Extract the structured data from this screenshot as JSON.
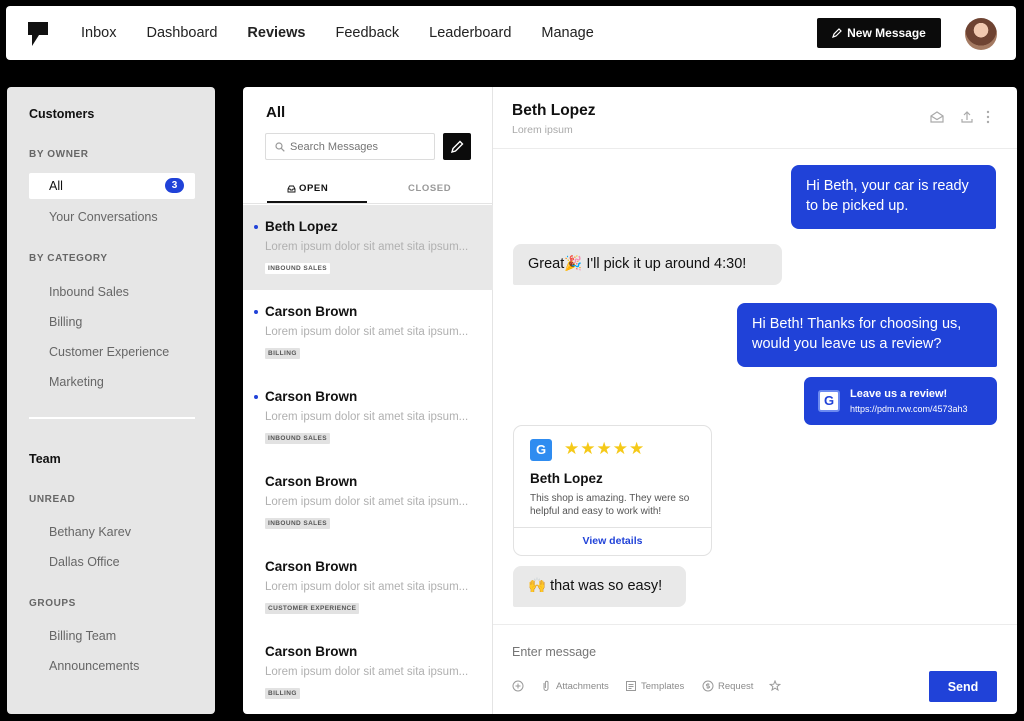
{
  "nav": {
    "items": [
      "Inbox",
      "Dashboard",
      "Reviews",
      "Feedback",
      "Leaderboard",
      "Manage"
    ],
    "active": "Reviews",
    "new_message": "New Message"
  },
  "sidebar": {
    "customers_title": "Customers",
    "by_owner": "BY OWNER",
    "all_label": "All",
    "all_count": "3",
    "your_conversations": "Your Conversations",
    "by_category": "BY CATEGORY",
    "categories": [
      "Inbound Sales",
      "Billing",
      "Customer Experience",
      "Marketing"
    ],
    "team_title": "Team",
    "unread": "UNREAD",
    "unread_items": [
      "Bethany Karev",
      "Dallas Office"
    ],
    "groups": "GROUPS",
    "group_items": [
      "Billing Team",
      "Announcements"
    ]
  },
  "list": {
    "title": "All",
    "search_placeholder": "Search Messages",
    "tab_open": "OPEN",
    "tab_closed": "CLOSED",
    "conversations": [
      {
        "name": "Beth Lopez",
        "preview": "Lorem ipsum dolor sit amet sita ipsum...",
        "tag": "INBOUND SALES"
      },
      {
        "name": "Carson Brown",
        "preview": "Lorem ipsum dolor sit amet sita ipsum...",
        "tag": "BILLING"
      },
      {
        "name": "Carson Brown",
        "preview": "Lorem ipsum dolor sit amet sita ipsum...",
        "tag": "INBOUND SALES"
      },
      {
        "name": "Carson Brown",
        "preview": "Lorem ipsum dolor sit amet sita ipsum...",
        "tag": "INBOUND SALES"
      },
      {
        "name": "Carson Brown",
        "preview": "Lorem ipsum dolor sit amet sita ipsum...",
        "tag": "CUSTOMER EXPERIENCE"
      },
      {
        "name": "Carson Brown",
        "preview": "Lorem ipsum dolor sit amet sita ipsum...",
        "tag": "BILLING"
      }
    ]
  },
  "conversation": {
    "name": "Beth Lopez",
    "subtitle": "Lorem ipsum",
    "messages": {
      "m1": "Hi Beth, your car is ready to be picked up.",
      "m2": "Great🎉 I'll pick it up around 4:30!",
      "m3": "Hi Beth! Thanks for choosing us, would you leave us a review?",
      "m6": "🙌 that was so easy!"
    },
    "link": {
      "title": "Leave us a review!",
      "url": "https://pdm.rvw.com/4573ah3"
    },
    "review": {
      "g": "G",
      "stars": "★★★★★",
      "name": "Beth Lopez",
      "text": "This shop is amazing. They were so helpful and easy to work with!",
      "view": "View details"
    },
    "input_placeholder": "Enter message",
    "tools": [
      "Attachments",
      "Templates",
      "Request"
    ],
    "send": "Send"
  },
  "colors": {
    "accent": "#2042d8",
    "star": "#f5c918",
    "google_blue": "#2f8cf0"
  }
}
